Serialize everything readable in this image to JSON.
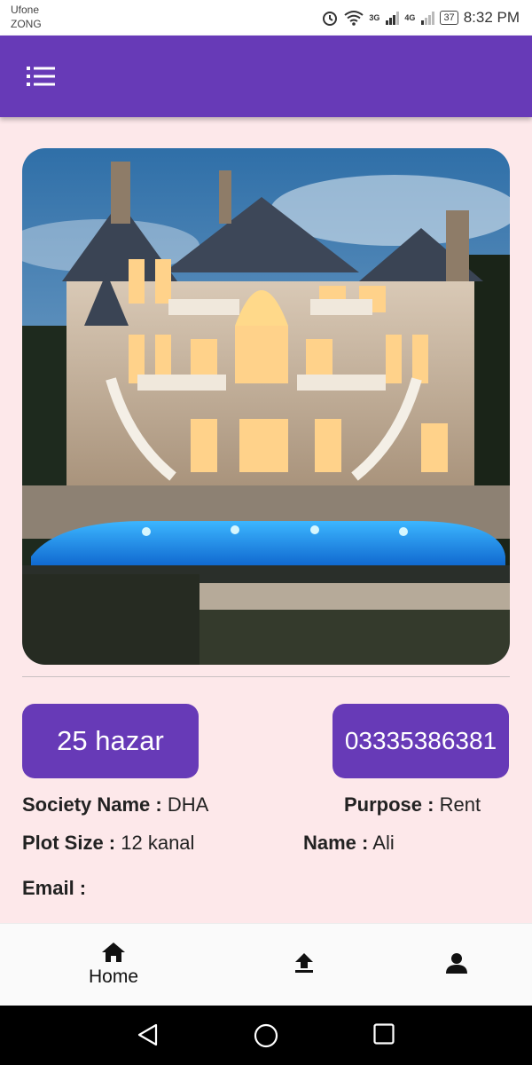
{
  "status_bar": {
    "carrier1": "Ufone",
    "carrier2": "ZONG",
    "signal1": "3G",
    "signal2": "4G",
    "battery": "37",
    "time": "8:32 PM",
    "icons": [
      "alarm-icon",
      "wifi-icon",
      "signal-icon",
      "battery-icon"
    ]
  },
  "app_bar": {
    "menu_icon": "list-icon",
    "color": "#673ab7"
  },
  "listing": {
    "image": "mansion-with-pool-photo",
    "price": "25 hazar",
    "phone": "03335386381",
    "society_label": "Society Name :",
    "society_value": "DHA",
    "purpose_label": "Purpose :",
    "purpose_value": "Rent",
    "plot_label": "Plot Size :",
    "plot_value": "12 kanal",
    "name_label": "Name :",
    "name_value": "Ali",
    "email_label": "Email :"
  },
  "bottom_nav": {
    "home_label": "Home",
    "items": [
      "home-icon",
      "upload-icon",
      "person-icon"
    ]
  },
  "system_nav": [
    "back-icon",
    "home-circle-icon",
    "recents-icon"
  ]
}
